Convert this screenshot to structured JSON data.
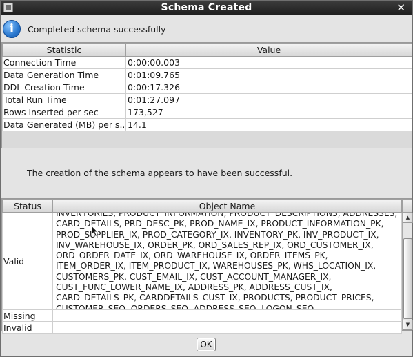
{
  "window": {
    "title": "Schema Created",
    "close_glyph": "✕"
  },
  "message": {
    "icon": "information-icon",
    "icon_glyph": "i",
    "text": "Completed schema successfully"
  },
  "statistics": {
    "columns": [
      "Statistic",
      "Value"
    ],
    "rows": [
      {
        "label": "Connection Time",
        "value": "0:00:00.003"
      },
      {
        "label": "Data Generation Time",
        "value": "0:01:09.765"
      },
      {
        "label": "DDL Creation Time",
        "value": "0:00:17.326"
      },
      {
        "label": "Total Run Time",
        "value": "0:01:27.097"
      },
      {
        "label": "Rows Inserted per sec",
        "value": "173,527"
      },
      {
        "label": "Data Generated (MB) per s...",
        "value": "14.1"
      }
    ]
  },
  "success_message": "The creation of the schema appears to have been successful.",
  "objects": {
    "columns": [
      "Status",
      "Object Name"
    ],
    "rows": [
      {
        "status": "Valid",
        "names": "INVENTORIES, PRODUCT_INFORMATION, PRODUCT_DESCRIPTIONS, ADDRESSES, CARD_DETAILS, PRD_DESC_PK, PROD_NAME_IX, PRODUCT_INFORMATION_PK, PROD_SUPPLIER_IX, PROD_CATEGORY_IX, INVENTORY_PK, INV_PRODUCT_IX, INV_WAREHOUSE_IX, ORDER_PK, ORD_SALES_REP_IX, ORD_CUSTOMER_IX, ORD_ORDER_DATE_IX, ORD_WAREHOUSE_IX, ORDER_ITEMS_PK, ITEM_ORDER_IX, ITEM_PRODUCT_IX, WAREHOUSES_PK, WHS_LOCATION_IX, CUSTOMERS_PK, CUST_EMAIL_IX, CUST_ACCOUNT_MANAGER_IX, CUST_FUNC_LOWER_NAME_IX, ADDRESS_PK, ADDRESS_CUST_IX, CARD_DETAILS_PK, CARDDETAILS_CUST_IX, PRODUCTS, PRODUCT_PRICES, CUSTOMER_SEQ, ORDERS_SEQ, ADDRESS_SEQ, LOGON_SEQ, CARD_DETAILS_SEQ, ORDERENTRY,"
      },
      {
        "status": "Missing",
        "names": ""
      },
      {
        "status": "Invalid",
        "names": ""
      }
    ]
  },
  "buttons": {
    "ok_label": "OK"
  },
  "scrollbar": {
    "up_glyph": "▲",
    "down_glyph": "▼"
  }
}
